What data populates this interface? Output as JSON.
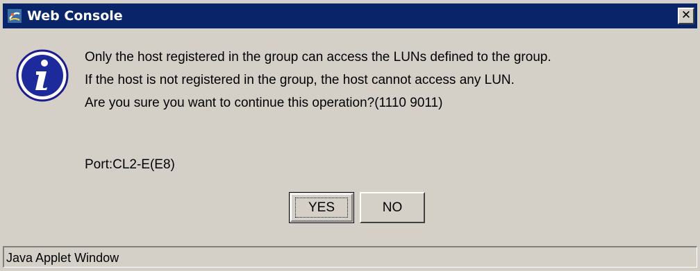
{
  "window": {
    "title": "Web Console",
    "close_glyph": "✕",
    "title_icon": "java-applet-icon",
    "titlebar_color": "#0a246a",
    "background_color": "#d4d0c8"
  },
  "dialog": {
    "icon": "info-icon",
    "message_lines": [
      "Only the host registered in the group can access the LUNs defined to the group.",
      "If the host is not registered in the group, the host cannot access any LUN.",
      "Are you sure you want to continue this operation?(1110 9011)"
    ],
    "port_text": "Port:CL2-E(E8)",
    "yes_label": "YES",
    "no_label": "NO"
  },
  "status_bar": {
    "text": "Java Applet Window"
  }
}
